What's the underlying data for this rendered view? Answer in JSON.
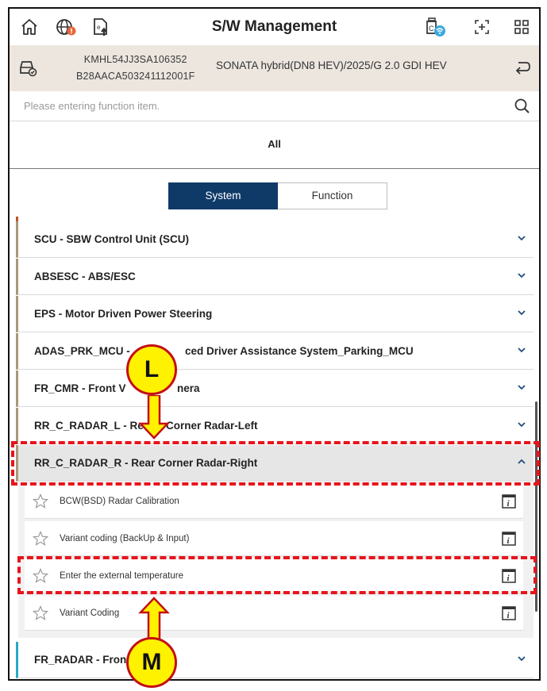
{
  "header": {
    "title": "S/W Management",
    "icons": [
      "home-icon",
      "globe-alert-icon",
      "export-icon",
      "vci-wifi-icon",
      "scan-icon",
      "grid-icon"
    ]
  },
  "vehicle": {
    "vin": "KMHL54JJ3SA106352",
    "vin2": "B28AACA503241112001F",
    "model": "SONATA hybrid(DN8 HEV)/2025/G 2.0 GDI HEV"
  },
  "search": {
    "placeholder": "Please entering function item."
  },
  "filter": {
    "all_label": "All",
    "system_label": "System",
    "function_label": "Function"
  },
  "systems": [
    {
      "label": "SCU - SBW Control Unit (SCU)"
    },
    {
      "label": "ABSESC - ABS/ESC"
    },
    {
      "label": "EPS - Motor Driven Power Steering"
    },
    {
      "label": "ADAS_PRK_MCU -",
      "label_rest": "ced Driver Assistance System_Parking_MCU"
    },
    {
      "label": "FR_CMR - Front V",
      "label_rest": "nera"
    },
    {
      "label": "RR_C_RADAR_L - Re",
      "label_rest": "Corner Radar-Left"
    },
    {
      "label": "RR_C_RADAR_R - Rear Corner Radar-Right"
    },
    {
      "label": "FR_RADAR - Fron"
    }
  ],
  "functions": [
    {
      "label": "BCW(BSD) Radar Calibration"
    },
    {
      "label": "Variant coding (BackUp & Input)"
    },
    {
      "label": "Enter the external temperature"
    },
    {
      "label": "Variant Coding"
    }
  ],
  "annotations": {
    "callout_l": "L",
    "callout_m": "M"
  },
  "colors": {
    "accent_navy": "#0f3a68",
    "vehicle_bar": "#ece6df",
    "annotation_red": "#e8141b",
    "callout_yellow": "#fff200"
  }
}
